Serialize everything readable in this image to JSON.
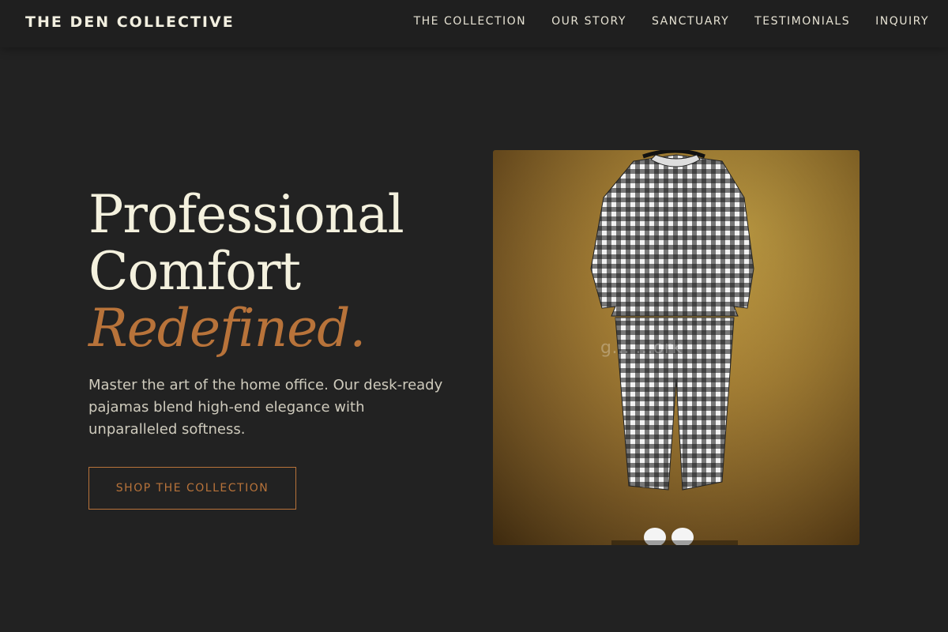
{
  "nav": {
    "brand": "THE DEN COLLECTIVE",
    "links": [
      "THE COLLECTION",
      "OUR STORY",
      "SANCTUARY",
      "TESTIMONIALS",
      "INQUIRY"
    ]
  },
  "hero": {
    "headline_line1": "Professional",
    "headline_line2": "Comfort",
    "headline_accent": "Redefined.",
    "subtext": "Master the art of the home office. Our desk-ready pajamas blend high-end elegance with unparalleled softness.",
    "cta_label": "SHOP THE COLLECTION"
  },
  "image": {
    "description_icon": "gingham-pajama-set-photo",
    "watermark": "g... ...ork"
  },
  "colors": {
    "background": "#222222",
    "nav_background": "#1f1f1f",
    "text_light": "#f4f1de",
    "accent": "#b8733a"
  }
}
